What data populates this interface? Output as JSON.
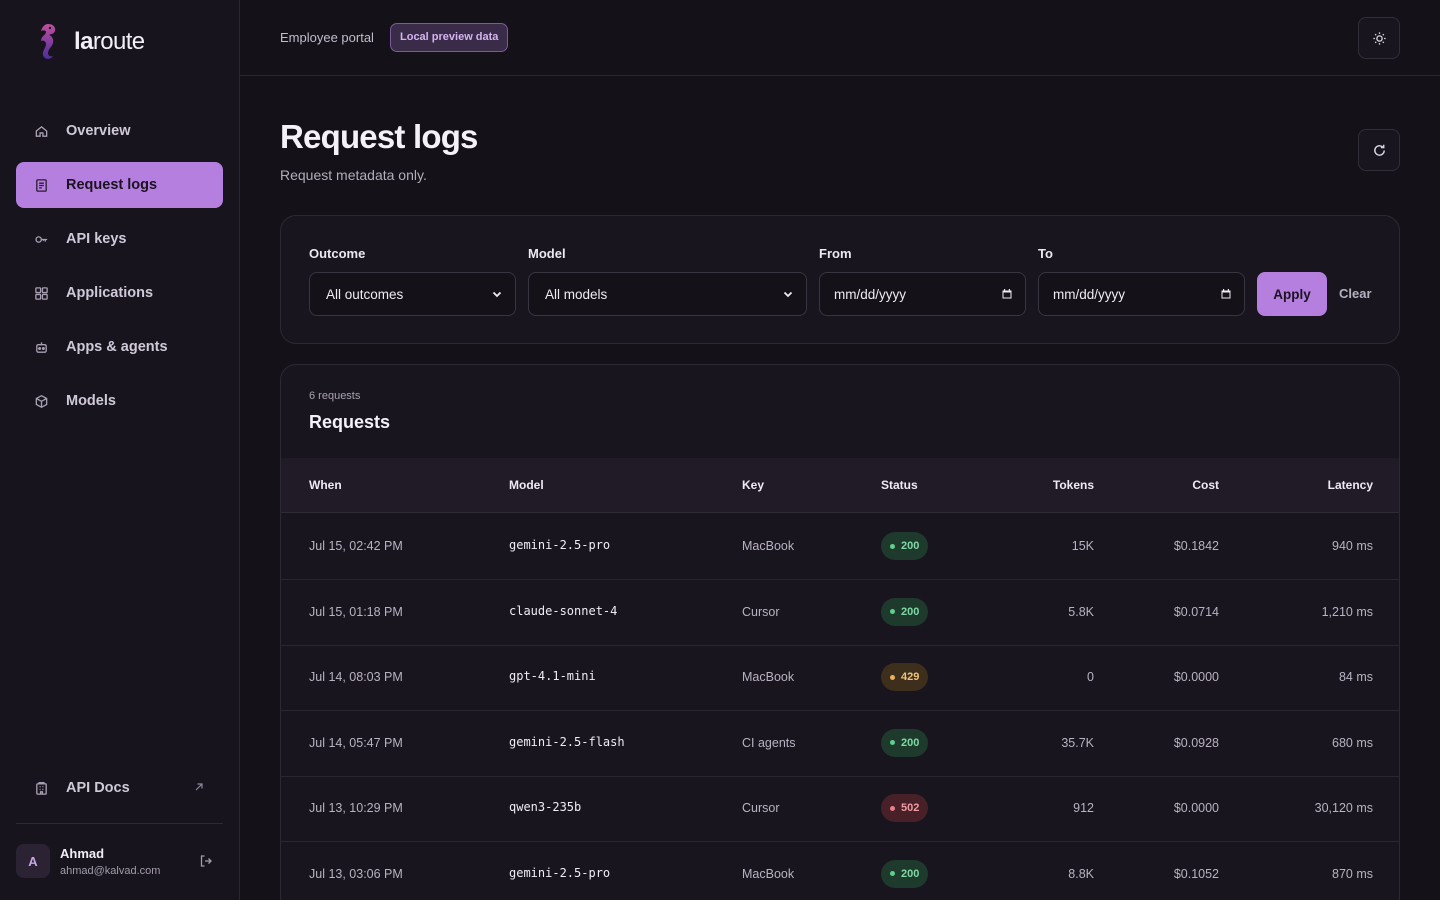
{
  "brand": {
    "name_bold": "la",
    "name_rest": "route"
  },
  "sidebar": {
    "items": [
      {
        "label": "Overview",
        "icon": "home-icon",
        "active": false
      },
      {
        "label": "Request logs",
        "icon": "document-icon",
        "active": true
      },
      {
        "label": "API keys",
        "icon": "key-icon",
        "active": false
      },
      {
        "label": "Applications",
        "icon": "grid-icon",
        "active": false
      },
      {
        "label": "Apps & agents",
        "icon": "robot-icon",
        "active": false
      },
      {
        "label": "Models",
        "icon": "cube-icon",
        "active": false
      }
    ],
    "docs_label": "API Docs"
  },
  "user": {
    "initial": "A",
    "name": "Ahmad",
    "email": "ahmad@kalvad.com"
  },
  "header": {
    "portal_label": "Employee portal",
    "preview_badge": "Local preview data"
  },
  "page": {
    "title": "Request logs",
    "subtitle": "Request metadata only."
  },
  "filters": {
    "outcome_label": "Outcome",
    "outcome_value": "All outcomes",
    "model_label": "Model",
    "model_value": "All models",
    "from_label": "From",
    "from_placeholder": "mm/dd/yyyy",
    "to_label": "To",
    "to_placeholder": "mm/dd/yyyy",
    "apply_label": "Apply",
    "clear_label": "Clear"
  },
  "requests": {
    "count_label": "6 requests",
    "title": "Requests",
    "columns": [
      "When",
      "Model",
      "Key",
      "Status",
      "Tokens",
      "Cost",
      "Latency"
    ],
    "rows": [
      {
        "when": "Jul 15, 02:42 PM",
        "model": "gemini-2.5-pro",
        "key": "MacBook",
        "status": "200",
        "tokens": "15K",
        "cost": "$0.1842",
        "latency": "940 ms"
      },
      {
        "when": "Jul 15, 01:18 PM",
        "model": "claude-sonnet-4",
        "key": "Cursor",
        "status": "200",
        "tokens": "5.8K",
        "cost": "$0.0714",
        "latency": "1,210 ms"
      },
      {
        "when": "Jul 14, 08:03 PM",
        "model": "gpt-4.1-mini",
        "key": "MacBook",
        "status": "429",
        "tokens": "0",
        "cost": "$0.0000",
        "latency": "84 ms"
      },
      {
        "when": "Jul 14, 05:47 PM",
        "model": "gemini-2.5-flash",
        "key": "CI agents",
        "status": "200",
        "tokens": "35.7K",
        "cost": "$0.0928",
        "latency": "680 ms"
      },
      {
        "when": "Jul 13, 10:29 PM",
        "model": "qwen3-235b",
        "key": "Cursor",
        "status": "502",
        "tokens": "912",
        "cost": "$0.0000",
        "latency": "30,120 ms"
      },
      {
        "when": "Jul 13, 03:06 PM",
        "model": "gemini-2.5-pro",
        "key": "MacBook",
        "status": "200",
        "tokens": "8.8K",
        "cost": "$0.1052",
        "latency": "870 ms"
      }
    ]
  },
  "colors": {
    "accent": "#b57fe0",
    "background": "#141118",
    "status_ok": "#5fcf8d",
    "status_warn": "#e9b25b",
    "status_error": "#ec7d8a"
  }
}
